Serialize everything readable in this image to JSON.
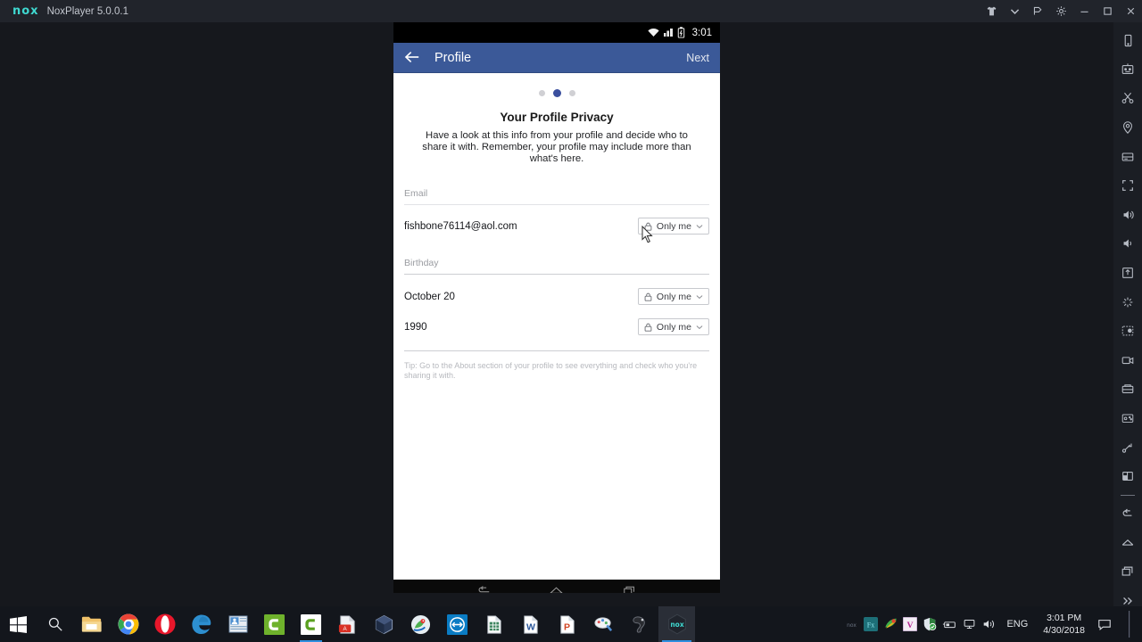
{
  "window": {
    "logo_text": "nox",
    "title": "NoxPlayer 5.0.0.1",
    "controls": [
      {
        "name": "theme-shirt-icon",
        "glyph": "shirt"
      },
      {
        "name": "chevron-down-icon",
        "glyph": "chevron"
      },
      {
        "name": "pin-icon",
        "glyph": "pin"
      },
      {
        "name": "gear-icon",
        "glyph": "gear"
      },
      {
        "name": "minimize-icon",
        "glyph": "minimize"
      },
      {
        "name": "maximize-icon",
        "glyph": "maximize"
      },
      {
        "name": "close-icon",
        "glyph": "close"
      }
    ]
  },
  "side_toolbar": {
    "items": [
      {
        "name": "shake-phone-icon"
      },
      {
        "name": "keyboard-macro-icon"
      },
      {
        "name": "scissors-screenshot-icon"
      },
      {
        "name": "location-icon"
      },
      {
        "name": "multi-drive-icon"
      },
      {
        "name": "fullscreen-icon"
      },
      {
        "name": "volume-up-icon"
      },
      {
        "name": "volume-down-icon"
      },
      {
        "name": "apk-install-icon"
      },
      {
        "name": "shake-burst-icon"
      },
      {
        "name": "macro-recorder-icon"
      },
      {
        "name": "video-record-icon"
      },
      {
        "name": "file-share-icon"
      },
      {
        "name": "keymapping-icon"
      },
      {
        "name": "drag-resize-icon"
      },
      {
        "name": "multi-instance-icon"
      },
      {
        "name": "back-icon"
      },
      {
        "name": "home-icon"
      },
      {
        "name": "recents-icon"
      },
      {
        "name": "more-icon"
      }
    ]
  },
  "emulator": {
    "status_bar": {
      "clock": "3:01",
      "icons": [
        "wifi-icon",
        "signal-icon",
        "battery-charging-icon"
      ]
    },
    "header": {
      "back_label": "back-arrow",
      "title": "Profile",
      "next_label": "Next"
    },
    "pager": {
      "total": 3,
      "active_index": 1
    },
    "content": {
      "title": "Your Profile Privacy",
      "subtitle": "Have a look at this info from your profile and decide who to share it with. Remember, your profile may include more than what's here.",
      "sections": [
        {
          "label": "Email",
          "rows": [
            {
              "value": "fishbone76114@aol.com",
              "privacy": "Only me"
            }
          ]
        },
        {
          "label": "Birthday",
          "rows": [
            {
              "value": "October 20",
              "privacy": "Only me"
            },
            {
              "value": "1990",
              "privacy": "Only me"
            }
          ]
        }
      ],
      "tip": "Tip: Go to the About section of your profile to see everything and check who you're sharing it with."
    },
    "nav_bar": {
      "items": [
        "back-icon",
        "home-icon",
        "recents-icon"
      ]
    }
  },
  "taskbar": {
    "items": [
      {
        "name": "start-button",
        "label": "Start"
      },
      {
        "name": "search-button",
        "label": "Search"
      },
      {
        "name": "file-explorer-button",
        "label": "File Explorer"
      },
      {
        "name": "chrome-button",
        "label": "Google Chrome"
      },
      {
        "name": "opera-button",
        "label": "Opera"
      },
      {
        "name": "edge-button",
        "label": "Microsoft Edge"
      },
      {
        "name": "contacts-app-button",
        "label": "Contacts"
      },
      {
        "name": "camtasia-button",
        "label": "Camtasia"
      },
      {
        "name": "camtasia-editor-button",
        "label": "Camtasia Editor"
      },
      {
        "name": "pdf-app-button",
        "label": "PDF Tool"
      },
      {
        "name": "virtualbox-button",
        "label": "VirtualBox"
      },
      {
        "name": "parrot-app-button",
        "label": "Parrot App"
      },
      {
        "name": "teamviewer-button",
        "label": "TeamViewer"
      },
      {
        "name": "excel-button",
        "label": "Excel"
      },
      {
        "name": "word-button",
        "label": "Word"
      },
      {
        "name": "powerpoint-button",
        "label": "PowerPoint"
      },
      {
        "name": "paint-app-button",
        "label": "Paint Tool"
      },
      {
        "name": "utility-app-button",
        "label": "Utility"
      },
      {
        "name": "noxplayer-button",
        "label": "NoxPlayer"
      }
    ],
    "tray": {
      "icons": [
        {
          "name": "nox-tray-icon",
          "label": "nox"
        },
        {
          "name": "fx-tray-icon",
          "label": "Fx"
        },
        {
          "name": "colorwheel-tray-icon",
          "label": "Color"
        },
        {
          "name": "vegas-tray-icon",
          "label": "V"
        },
        {
          "name": "defender-tray-icon",
          "label": "Windows Defender"
        },
        {
          "name": "usb-tray-icon",
          "label": "USB"
        },
        {
          "name": "network-tray-icon",
          "label": "Network"
        },
        {
          "name": "volume-tray-icon",
          "label": "Volume"
        }
      ],
      "language": "ENG",
      "time": "3:01 PM",
      "date": "4/30/2018",
      "action_center": "notifications-icon",
      "show_desktop": "show-desktop-button"
    }
  },
  "colors": {
    "facebook_blue": "#3b5998",
    "nox_accent": "#3fd8d0",
    "taskbar_bg": "#13161c",
    "active_dot": "#3b4f9e"
  }
}
